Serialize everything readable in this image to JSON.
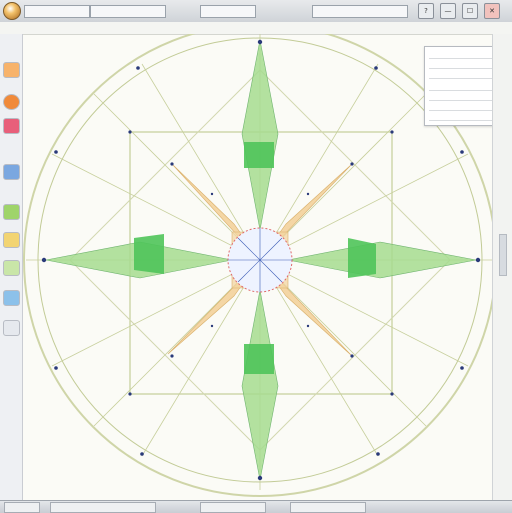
{
  "window": {
    "quick_access": [
      "",
      "",
      "",
      ""
    ],
    "window_buttons": [
      "?",
      "—",
      "☐",
      "✕"
    ]
  },
  "toolbar": {
    "left_text": ""
  },
  "document": {
    "header": ""
  },
  "properties_panel": {
    "rows": [
      "",
      "",
      "",
      "",
      "",
      "",
      ""
    ]
  },
  "status": {
    "items": [
      "",
      "",
      "",
      ""
    ]
  },
  "icons": [
    "app-orb-icon",
    "rectangle-tool-icon",
    "circle-tool-icon",
    "fill-icon",
    "layers-icon",
    "zoom-icon"
  ],
  "colors": {
    "green": "#6fcf73",
    "orange": "#f2c98a",
    "outline": "#b8c48f",
    "accent_red": "#e06a6a",
    "accent_blue": "#3b5bb5"
  }
}
